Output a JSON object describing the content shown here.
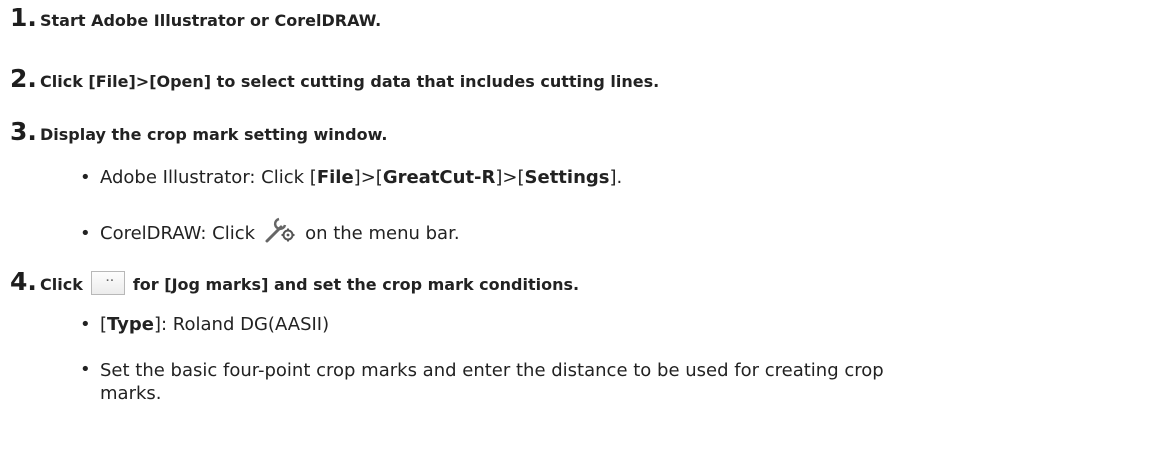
{
  "steps": [
    {
      "number": "1.",
      "text": "Start Adobe Illustrator or CorelDRAW."
    },
    {
      "number": "2.",
      "text": "Click [File]>[Open] to select cutting data that includes cutting lines."
    },
    {
      "number": "3.",
      "text": "Display the crop mark setting window."
    },
    {
      "number": "4.",
      "text_before": "Click",
      "text_after": "for [Jog marks] and set the crop mark conditions."
    }
  ],
  "step3_bullets": {
    "illustrator": {
      "prefix": "Adobe Illustrator: Click [",
      "file": "File",
      "sep1": "]>[",
      "greatcut": "GreatCut-R",
      "sep2": "]>[",
      "settings": "Settings",
      "suffix": "]."
    },
    "corel": {
      "prefix": "CorelDRAW: Click",
      "suffix": "on the menu bar."
    }
  },
  "step4_bullets": {
    "type": {
      "open": "[",
      "label": "Type",
      "close": "]: Roland DG(AASII)"
    },
    "basic": {
      "line1": "Set the basic four-point crop marks and enter the distance to be used for creating crop",
      "line2": "marks."
    }
  },
  "icons": {
    "settings": "wrench-gear-icon",
    "jog": "ellipsis-button-icon"
  },
  "bullet_char": "•"
}
